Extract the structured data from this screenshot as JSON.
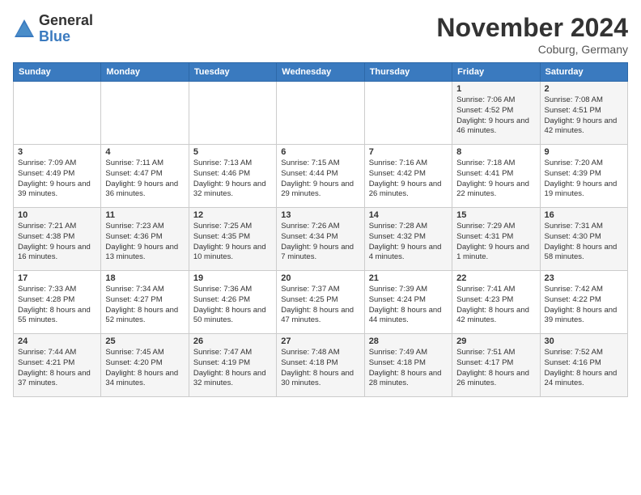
{
  "logo": {
    "general": "General",
    "blue": "Blue"
  },
  "header": {
    "month": "November 2024",
    "location": "Coburg, Germany"
  },
  "weekdays": [
    "Sunday",
    "Monday",
    "Tuesday",
    "Wednesday",
    "Thursday",
    "Friday",
    "Saturday"
  ],
  "weeks": [
    [
      {
        "day": "",
        "sunrise": "",
        "sunset": "",
        "daylight": ""
      },
      {
        "day": "",
        "sunrise": "",
        "sunset": "",
        "daylight": ""
      },
      {
        "day": "",
        "sunrise": "",
        "sunset": "",
        "daylight": ""
      },
      {
        "day": "",
        "sunrise": "",
        "sunset": "",
        "daylight": ""
      },
      {
        "day": "",
        "sunrise": "",
        "sunset": "",
        "daylight": ""
      },
      {
        "day": "1",
        "sunrise": "Sunrise: 7:06 AM",
        "sunset": "Sunset: 4:52 PM",
        "daylight": "Daylight: 9 hours and 46 minutes."
      },
      {
        "day": "2",
        "sunrise": "Sunrise: 7:08 AM",
        "sunset": "Sunset: 4:51 PM",
        "daylight": "Daylight: 9 hours and 42 minutes."
      }
    ],
    [
      {
        "day": "3",
        "sunrise": "Sunrise: 7:09 AM",
        "sunset": "Sunset: 4:49 PM",
        "daylight": "Daylight: 9 hours and 39 minutes."
      },
      {
        "day": "4",
        "sunrise": "Sunrise: 7:11 AM",
        "sunset": "Sunset: 4:47 PM",
        "daylight": "Daylight: 9 hours and 36 minutes."
      },
      {
        "day": "5",
        "sunrise": "Sunrise: 7:13 AM",
        "sunset": "Sunset: 4:46 PM",
        "daylight": "Daylight: 9 hours and 32 minutes."
      },
      {
        "day": "6",
        "sunrise": "Sunrise: 7:15 AM",
        "sunset": "Sunset: 4:44 PM",
        "daylight": "Daylight: 9 hours and 29 minutes."
      },
      {
        "day": "7",
        "sunrise": "Sunrise: 7:16 AM",
        "sunset": "Sunset: 4:42 PM",
        "daylight": "Daylight: 9 hours and 26 minutes."
      },
      {
        "day": "8",
        "sunrise": "Sunrise: 7:18 AM",
        "sunset": "Sunset: 4:41 PM",
        "daylight": "Daylight: 9 hours and 22 minutes."
      },
      {
        "day": "9",
        "sunrise": "Sunrise: 7:20 AM",
        "sunset": "Sunset: 4:39 PM",
        "daylight": "Daylight: 9 hours and 19 minutes."
      }
    ],
    [
      {
        "day": "10",
        "sunrise": "Sunrise: 7:21 AM",
        "sunset": "Sunset: 4:38 PM",
        "daylight": "Daylight: 9 hours and 16 minutes."
      },
      {
        "day": "11",
        "sunrise": "Sunrise: 7:23 AM",
        "sunset": "Sunset: 4:36 PM",
        "daylight": "Daylight: 9 hours and 13 minutes."
      },
      {
        "day": "12",
        "sunrise": "Sunrise: 7:25 AM",
        "sunset": "Sunset: 4:35 PM",
        "daylight": "Daylight: 9 hours and 10 minutes."
      },
      {
        "day": "13",
        "sunrise": "Sunrise: 7:26 AM",
        "sunset": "Sunset: 4:34 PM",
        "daylight": "Daylight: 9 hours and 7 minutes."
      },
      {
        "day": "14",
        "sunrise": "Sunrise: 7:28 AM",
        "sunset": "Sunset: 4:32 PM",
        "daylight": "Daylight: 9 hours and 4 minutes."
      },
      {
        "day": "15",
        "sunrise": "Sunrise: 7:29 AM",
        "sunset": "Sunset: 4:31 PM",
        "daylight": "Daylight: 9 hours and 1 minute."
      },
      {
        "day": "16",
        "sunrise": "Sunrise: 7:31 AM",
        "sunset": "Sunset: 4:30 PM",
        "daylight": "Daylight: 8 hours and 58 minutes."
      }
    ],
    [
      {
        "day": "17",
        "sunrise": "Sunrise: 7:33 AM",
        "sunset": "Sunset: 4:28 PM",
        "daylight": "Daylight: 8 hours and 55 minutes."
      },
      {
        "day": "18",
        "sunrise": "Sunrise: 7:34 AM",
        "sunset": "Sunset: 4:27 PM",
        "daylight": "Daylight: 8 hours and 52 minutes."
      },
      {
        "day": "19",
        "sunrise": "Sunrise: 7:36 AM",
        "sunset": "Sunset: 4:26 PM",
        "daylight": "Daylight: 8 hours and 50 minutes."
      },
      {
        "day": "20",
        "sunrise": "Sunrise: 7:37 AM",
        "sunset": "Sunset: 4:25 PM",
        "daylight": "Daylight: 8 hours and 47 minutes."
      },
      {
        "day": "21",
        "sunrise": "Sunrise: 7:39 AM",
        "sunset": "Sunset: 4:24 PM",
        "daylight": "Daylight: 8 hours and 44 minutes."
      },
      {
        "day": "22",
        "sunrise": "Sunrise: 7:41 AM",
        "sunset": "Sunset: 4:23 PM",
        "daylight": "Daylight: 8 hours and 42 minutes."
      },
      {
        "day": "23",
        "sunrise": "Sunrise: 7:42 AM",
        "sunset": "Sunset: 4:22 PM",
        "daylight": "Daylight: 8 hours and 39 minutes."
      }
    ],
    [
      {
        "day": "24",
        "sunrise": "Sunrise: 7:44 AM",
        "sunset": "Sunset: 4:21 PM",
        "daylight": "Daylight: 8 hours and 37 minutes."
      },
      {
        "day": "25",
        "sunrise": "Sunrise: 7:45 AM",
        "sunset": "Sunset: 4:20 PM",
        "daylight": "Daylight: 8 hours and 34 minutes."
      },
      {
        "day": "26",
        "sunrise": "Sunrise: 7:47 AM",
        "sunset": "Sunset: 4:19 PM",
        "daylight": "Daylight: 8 hours and 32 minutes."
      },
      {
        "day": "27",
        "sunrise": "Sunrise: 7:48 AM",
        "sunset": "Sunset: 4:18 PM",
        "daylight": "Daylight: 8 hours and 30 minutes."
      },
      {
        "day": "28",
        "sunrise": "Sunrise: 7:49 AM",
        "sunset": "Sunset: 4:18 PM",
        "daylight": "Daylight: 8 hours and 28 minutes."
      },
      {
        "day": "29",
        "sunrise": "Sunrise: 7:51 AM",
        "sunset": "Sunset: 4:17 PM",
        "daylight": "Daylight: 8 hours and 26 minutes."
      },
      {
        "day": "30",
        "sunrise": "Sunrise: 7:52 AM",
        "sunset": "Sunset: 4:16 PM",
        "daylight": "Daylight: 8 hours and 24 minutes."
      }
    ]
  ]
}
